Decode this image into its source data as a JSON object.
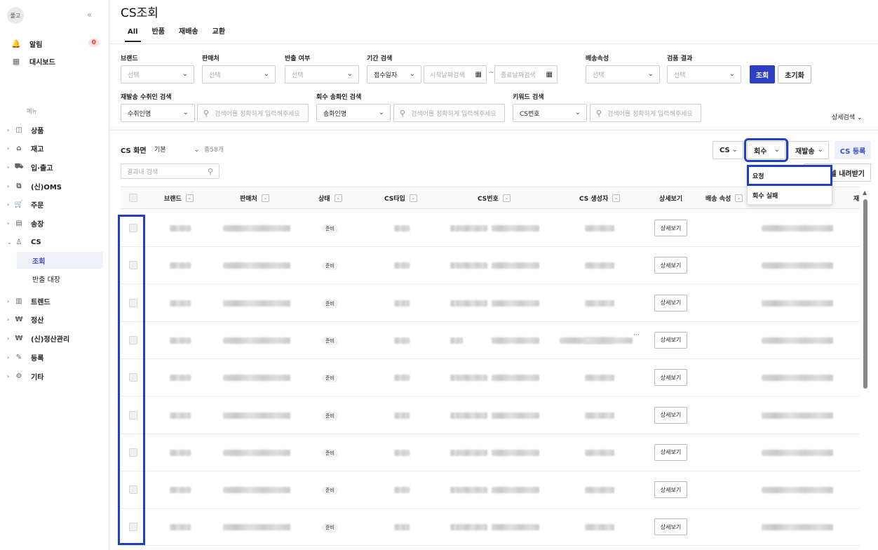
{
  "sidebar": {
    "logo": "풀고",
    "collapse": "«",
    "top": [
      {
        "label": "알림",
        "icon": "bell-icon",
        "badge": "0"
      },
      {
        "label": "대시보드",
        "icon": "dashboard-icon"
      }
    ],
    "menu_header": "메뉴",
    "items": [
      {
        "label": "상품",
        "icon": "shopping-bag-icon"
      },
      {
        "label": "재고",
        "icon": "warehouse-icon"
      },
      {
        "label": "입·출고",
        "icon": "truck-icon"
      },
      {
        "label": "(신)OMS",
        "icon": "oms-icon"
      },
      {
        "label": "주문",
        "icon": "cart-icon"
      },
      {
        "label": "송장",
        "icon": "invoice-icon"
      },
      {
        "label": "CS",
        "icon": "person-icon"
      },
      {
        "label": "트렌드",
        "icon": "bar-chart-icon"
      },
      {
        "label": "정산",
        "icon": "won-icon"
      },
      {
        "label": "(신)정산관리",
        "icon": "won-icon"
      },
      {
        "label": "등록",
        "icon": "pencil-icon"
      },
      {
        "label": "기타",
        "icon": "gear-icon"
      }
    ],
    "cs_sub": [
      "조회",
      "반출 대장"
    ]
  },
  "page": {
    "title": "CS조회",
    "tabs": [
      "All",
      "반품",
      "재배송",
      "교환"
    ]
  },
  "filters": {
    "brand": {
      "label": "브랜드",
      "value": "선택"
    },
    "seller": {
      "label": "판매처",
      "value": "선택"
    },
    "export": {
      "label": "반출 여부",
      "value": "선택"
    },
    "period": {
      "label": "기간 검색",
      "type": "접수일자",
      "start_placeholder": "시작날짜검색",
      "tilde": "~",
      "end_placeholder": "종료날짜검색"
    },
    "delivery": {
      "label": "배송속성",
      "value": "선택"
    },
    "inspect": {
      "label": "검품 결과",
      "value": "선택"
    },
    "search_button": "조회",
    "reset_button": "초기화",
    "resend": {
      "label": "재발송 수취인 검색",
      "type": "수취인명",
      "placeholder": "검색어를 정확하게 입력해주세요"
    },
    "return": {
      "label": "회수 송화인 검색",
      "type": "송화인명",
      "placeholder": "검색어를 정확하게 입력해주세요"
    },
    "keyword": {
      "label": "키워드 검색",
      "type": "CS번호",
      "placeholder": "검색어를 정확하게 입력해주세요"
    },
    "detail_search": "상세검색"
  },
  "list": {
    "screen_label": "CS 화면",
    "view": "기본",
    "total": "총58개",
    "result_search_placeholder": "결과내 검색",
    "toolbar": {
      "cs": "CS",
      "return": "회수",
      "resend": "재발송",
      "register": "CS 등록",
      "download": "엑셀 내려받기"
    },
    "dropdown": [
      "요청",
      "회수 실패"
    ],
    "columns": [
      "브랜드",
      "판매처",
      "상태",
      "CS타입",
      "CS번호",
      "CS 생성자",
      "상세보기",
      "배송 속성",
      "재"
    ],
    "status_label": "준비",
    "detail_label": "상세보기",
    "row_count": 9
  }
}
